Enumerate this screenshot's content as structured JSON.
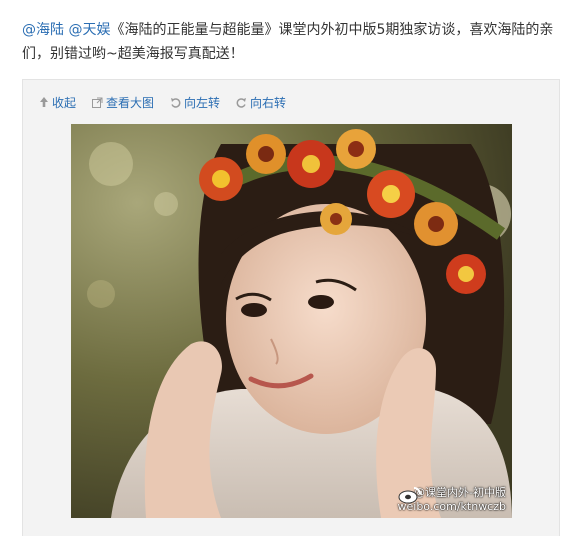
{
  "post": {
    "mention_1": "@海陆",
    "mention_2": "@天娱",
    "body": "《海陆的正能量与超能量》课堂内外初中版5期独家访谈，喜欢海陆的亲们，别错过哟~超美海报写真配送！"
  },
  "toolbar": {
    "collapse": "收起",
    "view_large": "查看大图",
    "rotate_left": "向左转",
    "rotate_right": "向右转"
  },
  "photo": {
    "watermark_handle": "@课堂内外-初中版",
    "watermark_url": "weibo.com/ktnwczb"
  },
  "colors": {
    "link": "#2b6eb3",
    "text": "#333333",
    "media_bg": "#f3f3f3"
  },
  "icons": [
    "arrow-up-icon",
    "external-link-icon",
    "rotate-left-icon",
    "rotate-right-icon",
    "weibo-logo-icon"
  ]
}
